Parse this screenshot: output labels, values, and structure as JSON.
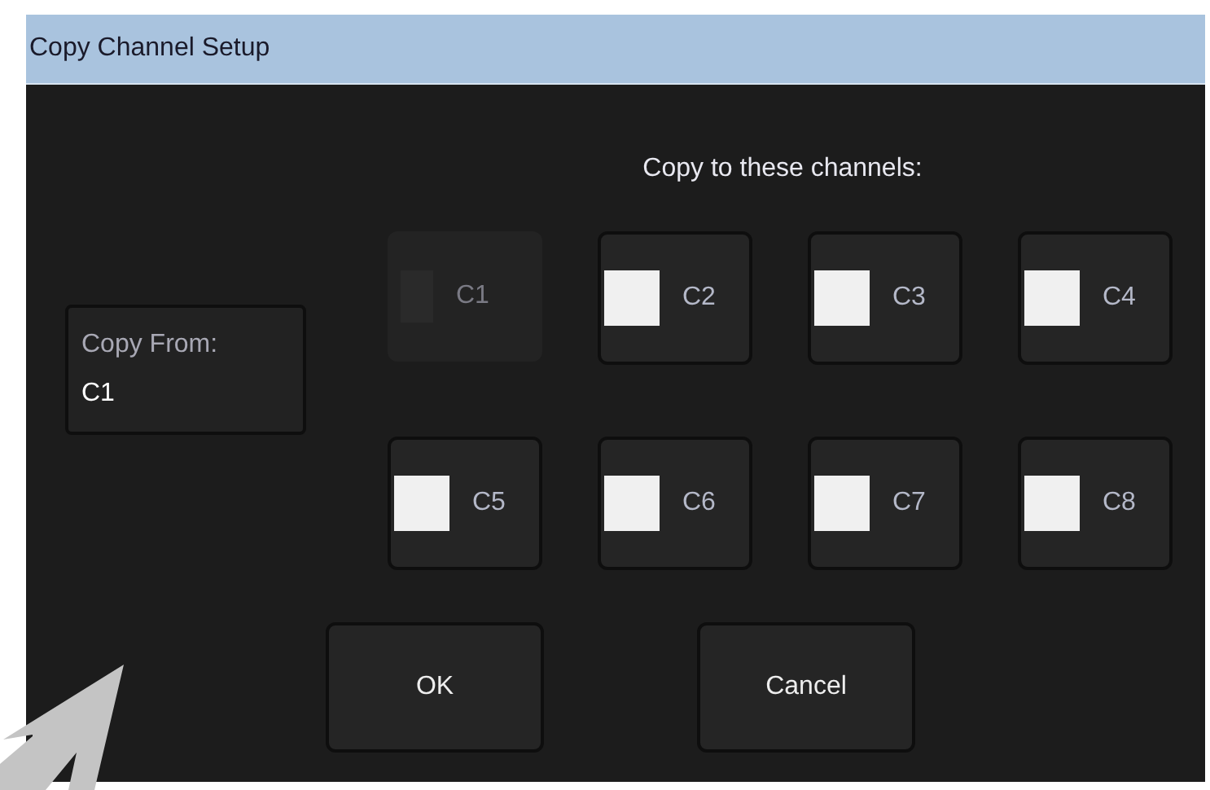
{
  "window": {
    "title": "Copy Channel Setup"
  },
  "copy_from": {
    "label": "Copy From:",
    "value": "C1"
  },
  "heading": "Copy to these channels:",
  "channels": [
    {
      "label": "C1",
      "checked": false,
      "disabled": true
    },
    {
      "label": "C2",
      "checked": false,
      "disabled": false
    },
    {
      "label": "C3",
      "checked": false,
      "disabled": false
    },
    {
      "label": "C4",
      "checked": false,
      "disabled": false
    },
    {
      "label": "C5",
      "checked": false,
      "disabled": false
    },
    {
      "label": "C6",
      "checked": false,
      "disabled": false
    },
    {
      "label": "C7",
      "checked": false,
      "disabled": false
    },
    {
      "label": "C8",
      "checked": false,
      "disabled": false
    }
  ],
  "buttons": [
    "OK",
    "Cancel"
  ]
}
